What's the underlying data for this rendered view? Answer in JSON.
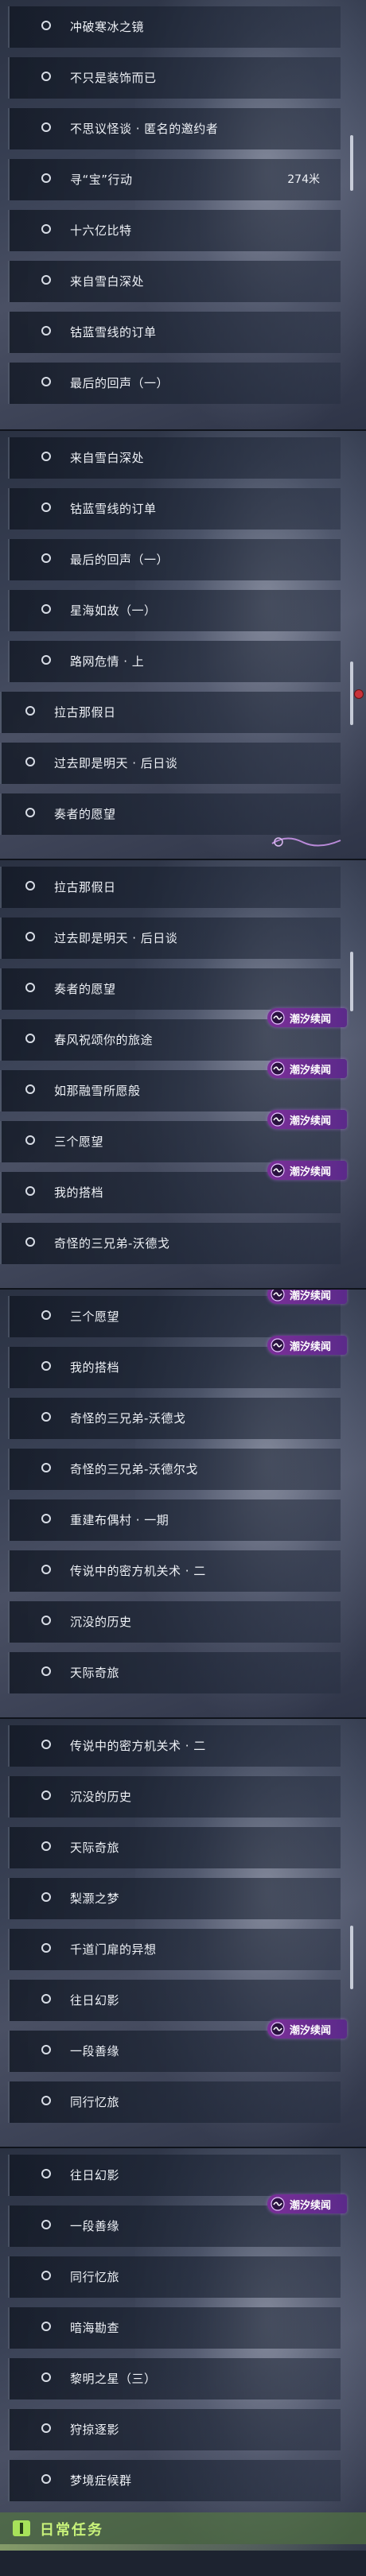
{
  "panels": [
    {
      "rows": [
        {
          "label": "冲破寒冰之镜",
          "distance": "",
          "badge": false
        },
        {
          "label": "不只是装饰而已",
          "distance": "",
          "badge": false
        },
        {
          "label": "不思议怪谈 · 匿名的邀约者",
          "distance": "",
          "badge": false
        },
        {
          "label": "寻“宝”行动",
          "distance": "274米",
          "badge": false
        },
        {
          "label": "十六亿比特",
          "distance": "",
          "badge": false
        },
        {
          "label": "来自雪白深处",
          "distance": "",
          "badge": false
        },
        {
          "label": "钴蓝雪线的订单",
          "distance": "",
          "badge": false
        },
        {
          "label": "最后的回声（一）",
          "distance": "",
          "badge": false
        }
      ]
    },
    {
      "rows": [
        {
          "label": "来自雪白深处",
          "distance": "",
          "badge": false
        },
        {
          "label": "钴蓝雪线的订单",
          "distance": "",
          "badge": false
        },
        {
          "label": "最后的回声（一）",
          "distance": "",
          "badge": false
        },
        {
          "label": "星海如故（一）",
          "distance": "",
          "badge": false
        },
        {
          "label": "路网危情 · 上",
          "distance": "",
          "badge": false
        },
        {
          "label": "拉古那假日",
          "distance": "",
          "badge": false
        },
        {
          "label": "过去即是明天 · 后日谈",
          "distance": "",
          "badge": false
        },
        {
          "label": "奏者的愿望",
          "distance": "",
          "badge": false
        }
      ]
    },
    {
      "rows": [
        {
          "label": "拉古那假日",
          "distance": "",
          "badge": false
        },
        {
          "label": "过去即是明天 · 后日谈",
          "distance": "",
          "badge": false
        },
        {
          "label": "奏者的愿望",
          "distance": "",
          "badge": false
        },
        {
          "label": "春风祝颂你的旅途",
          "distance": "",
          "badge": true
        },
        {
          "label": "如那融雪所愿般",
          "distance": "",
          "badge": true
        },
        {
          "label": "三个愿望",
          "distance": "",
          "badge": true
        },
        {
          "label": "我的搭档",
          "distance": "",
          "badge": true
        },
        {
          "label": "奇怪的三兄弟-沃德戈",
          "distance": "",
          "badge": false
        }
      ]
    },
    {
      "rows": [
        {
          "label": "三个愿望",
          "distance": "",
          "badge": true
        },
        {
          "label": "我的搭档",
          "distance": "",
          "badge": true
        },
        {
          "label": "奇怪的三兄弟-沃德戈",
          "distance": "",
          "badge": false
        },
        {
          "label": "奇怪的三兄弟-沃德尔戈",
          "distance": "",
          "badge": false
        },
        {
          "label": "重建布偶村 · 一期",
          "distance": "",
          "badge": false
        },
        {
          "label": "传说中的密方机关术 · 二",
          "distance": "",
          "badge": false
        },
        {
          "label": "沉没的历史",
          "distance": "",
          "badge": false
        },
        {
          "label": "天际奇旅",
          "distance": "",
          "badge": false
        }
      ]
    },
    {
      "rows": [
        {
          "label": "传说中的密方机关术 · 二",
          "distance": "",
          "badge": false
        },
        {
          "label": "沉没的历史",
          "distance": "",
          "badge": false
        },
        {
          "label": "天际奇旅",
          "distance": "",
          "badge": false
        },
        {
          "label": "梨灏之梦",
          "distance": "",
          "badge": false
        },
        {
          "label": "千道门扉的异想",
          "distance": "",
          "badge": false
        },
        {
          "label": "往日幻影",
          "distance": "",
          "badge": false
        },
        {
          "label": "一段善缘",
          "distance": "",
          "badge": true
        },
        {
          "label": "同行忆旅",
          "distance": "",
          "badge": false
        }
      ]
    },
    {
      "rows": [
        {
          "label": "往日幻影",
          "distance": "",
          "badge": false
        },
        {
          "label": "一段善缘",
          "distance": "",
          "badge": true
        },
        {
          "label": "同行忆旅",
          "distance": "",
          "badge": false
        },
        {
          "label": "暗海勘查",
          "distance": "",
          "badge": false
        },
        {
          "label": "黎明之星（三）",
          "distance": "",
          "badge": false
        },
        {
          "label": "狩掠逐影",
          "distance": "",
          "badge": false
        },
        {
          "label": "梦境症候群",
          "distance": "",
          "badge": false
        }
      ]
    }
  ],
  "badge_label": "潮汐续闻",
  "footer": {
    "title": "日常任务"
  },
  "colors": {
    "badge": "#7a2f98",
    "footer_accent": "#c8f27a",
    "alert_dot": "#c8323a"
  },
  "icons": {
    "quest": "circle-icon",
    "badge": "tide-icon",
    "footer": "daily-task-icon"
  }
}
